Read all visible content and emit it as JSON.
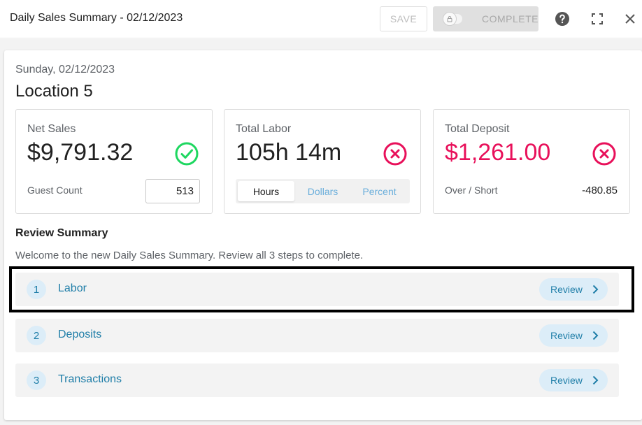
{
  "header": {
    "title": "Daily Sales Summary - 02/12/2023",
    "save_label": "SAVE",
    "complete_label": "COMPLETE",
    "icons": [
      "lock-icon",
      "help-icon",
      "fullscreen-icon",
      "close-icon"
    ]
  },
  "summary": {
    "date": "Sunday, 02/12/2023",
    "location": "Location 5"
  },
  "net_sales": {
    "label": "Net Sales",
    "value": "$9,791.32",
    "status": "ok",
    "guest_count_label": "Guest Count",
    "guest_count": "513"
  },
  "total_labor": {
    "label": "Total Labor",
    "value": "105h 14m",
    "status": "error",
    "units": [
      "Hours",
      "Dollars",
      "Percent"
    ],
    "selected_unit": "Hours"
  },
  "total_deposit": {
    "label": "Total Deposit",
    "value": "$1,261.00",
    "status": "error",
    "over_short_label": "Over / Short",
    "over_short": "-480.85"
  },
  "review": {
    "title": "Review Summary",
    "description": "Welcome to the new Daily Sales Summary. Review all 3 steps to complete.",
    "steps": [
      {
        "number": "1",
        "label": "Labor",
        "action": "Review"
      },
      {
        "number": "2",
        "label": "Deposits",
        "action": "Review"
      },
      {
        "number": "3",
        "label": "Transactions",
        "action": "Review"
      }
    ]
  },
  "colors": {
    "accent": "#1f7ea8",
    "success": "#1ed760",
    "error": "#e8105a",
    "pill_bg": "#dcedf8"
  }
}
